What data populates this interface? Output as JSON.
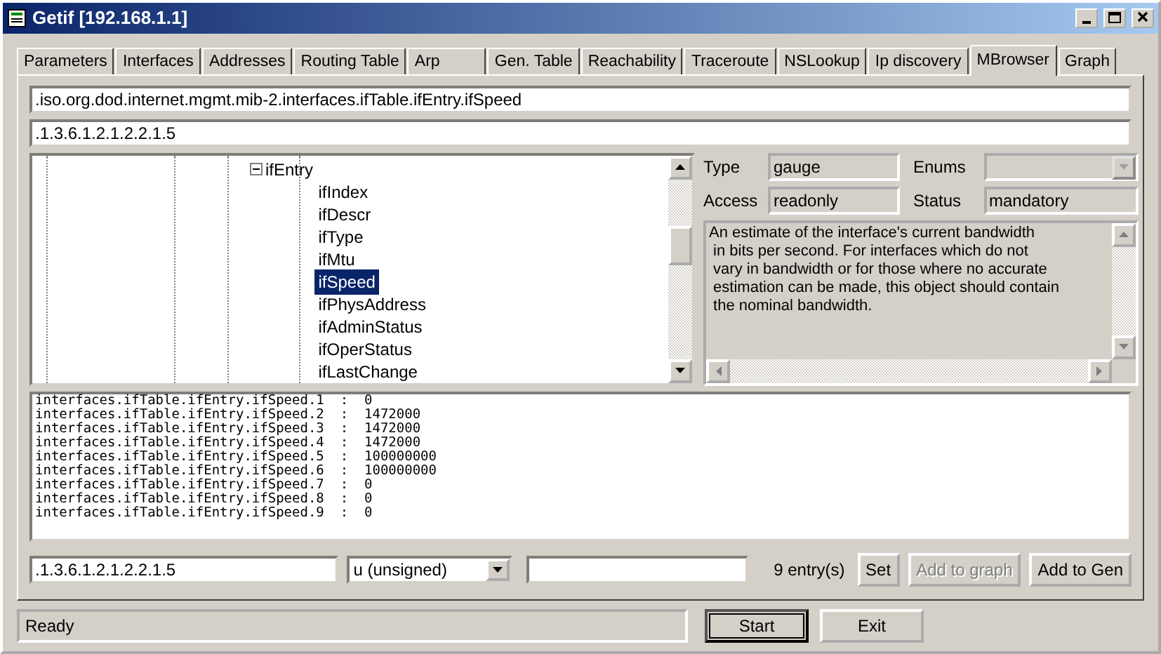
{
  "window": {
    "title": "Getif [192.168.1.1]"
  },
  "tabs": [
    {
      "label": "Parameters",
      "selected": false
    },
    {
      "label": "Interfaces",
      "selected": false
    },
    {
      "label": "Addresses",
      "selected": false
    },
    {
      "label": "Routing Table",
      "selected": false
    },
    {
      "label": "Arp",
      "selected": false
    },
    {
      "label": "Gen. Table",
      "selected": false
    },
    {
      "label": "Reachability",
      "selected": false
    },
    {
      "label": "Traceroute",
      "selected": false
    },
    {
      "label": "NSLookup",
      "selected": false
    },
    {
      "label": "Ip discovery",
      "selected": false
    },
    {
      "label": "MBrowser",
      "selected": true
    },
    {
      "label": "Graph",
      "selected": false
    }
  ],
  "oid_name": ".iso.org.dod.internet.mgmt.mib-2.interfaces.ifTable.ifEntry.ifSpeed",
  "oid_number": ".1.3.6.1.2.1.2.2.1.5",
  "tree": {
    "label": "ifEntry",
    "expanded": true,
    "children": [
      {
        "label": "ifIndex",
        "selected": false
      },
      {
        "label": "ifDescr",
        "selected": false
      },
      {
        "label": "ifType",
        "selected": false
      },
      {
        "label": "ifMtu",
        "selected": false
      },
      {
        "label": "ifSpeed",
        "selected": true
      },
      {
        "label": "ifPhysAddress",
        "selected": false
      },
      {
        "label": "ifAdminStatus",
        "selected": false
      },
      {
        "label": "ifOperStatus",
        "selected": false
      },
      {
        "label": "ifLastChange",
        "selected": false
      }
    ]
  },
  "info": {
    "type_label": "Type",
    "type": "gauge",
    "enums_label": "Enums",
    "access_label": "Access",
    "access": "readonly",
    "status_label": "Status",
    "status": "mandatory",
    "description": "An estimate of the interface's current bandwidth\n in bits per second. For interfaces which do not\n vary in bandwidth or for those where no accurate\n estimation can be made, this object should contain\n the nominal bandwidth."
  },
  "results": [
    "interfaces.ifTable.ifEntry.ifSpeed.1  :  0",
    "interfaces.ifTable.ifEntry.ifSpeed.2  :  1472000",
    "interfaces.ifTable.ifEntry.ifSpeed.3  :  1472000",
    "interfaces.ifTable.ifEntry.ifSpeed.4  :  1472000",
    "interfaces.ifTable.ifEntry.ifSpeed.5  :  100000000",
    "interfaces.ifTable.ifEntry.ifSpeed.6  :  100000000",
    "interfaces.ifTable.ifEntry.ifSpeed.7  :  0",
    "interfaces.ifTable.ifEntry.ifSpeed.8  :  0",
    "interfaces.ifTable.ifEntry.ifSpeed.9  :  0"
  ],
  "set_oid": ".1.3.6.1.2.1.2.2.1.5",
  "set_type": "u (unsigned)",
  "entry_count": "9 entry(s)",
  "buttons": [
    {
      "label": "Set",
      "disabled": false
    },
    {
      "label": "Add to graph",
      "disabled": true
    },
    {
      "label": "Add to Gen",
      "disabled": false
    }
  ],
  "status_bar": "Ready",
  "footer_buttons": [
    {
      "label": "Start",
      "focused": true
    },
    {
      "label": "Exit",
      "focused": false
    }
  ]
}
